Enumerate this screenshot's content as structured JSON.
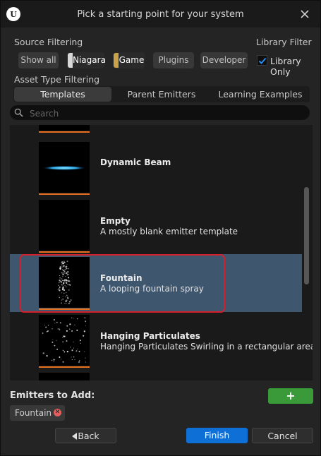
{
  "window": {
    "title": "Pick a starting point for your system",
    "logo_letter": "U"
  },
  "source_filtering": {
    "label": "Source Filtering",
    "chips": [
      {
        "label": "Show all",
        "stripe": ""
      },
      {
        "label": "Niagara",
        "stripe": "#d8d8d8"
      },
      {
        "label": "Game",
        "stripe": "#c9a24a"
      },
      {
        "label": "Plugins",
        "stripe": ""
      },
      {
        "label": "Developer",
        "stripe": ""
      }
    ]
  },
  "library_filter": {
    "label": "Library Filter",
    "checkbox_label": "Library Only",
    "checked": true
  },
  "asset_type": {
    "label": "Asset Type Filtering",
    "tabs": [
      "Templates",
      "Parent Emitters",
      "Learning Examples"
    ],
    "active_tab": "Templates"
  },
  "search": {
    "placeholder": "Search",
    "value": ""
  },
  "list": {
    "items": [
      {
        "name": "",
        "description": "",
        "thumbnail": "partial"
      },
      {
        "name": "Dynamic Beam",
        "description": "",
        "thumbnail": "beam"
      },
      {
        "name": "Empty",
        "description": "A mostly blank emitter template",
        "thumbnail": "empty"
      },
      {
        "name": "Fountain",
        "description": "A looping fountain spray",
        "thumbnail": "fountain",
        "selected": true
      },
      {
        "name": "Hanging Particulates",
        "description": "Hanging Particulates Swirling in a rectangular area",
        "thumbnail": "particulates"
      },
      {
        "name": "",
        "description": "",
        "thumbnail": "partial"
      }
    ]
  },
  "emitters_to_add": {
    "label": "Emitters to Add:",
    "add_label": "+",
    "items": [
      "Fountain"
    ]
  },
  "buttons": {
    "back": "Back",
    "finish": "Finish",
    "cancel": "Cancel"
  },
  "colors": {
    "accent_orange": "#e8711f",
    "selection_blue": "#3e566e",
    "finish_blue": "#0e6fd6",
    "add_green": "#3a9a3a",
    "highlight_red": "#d4202a"
  }
}
